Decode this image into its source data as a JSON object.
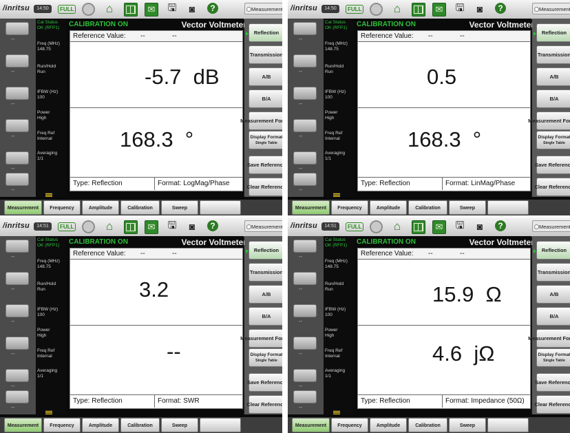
{
  "common": {
    "logo": "/inritsu",
    "full_badge": "FULL",
    "measurement_header": "Measurement",
    "cal_status_label": "Cal Status",
    "cal_status_value": "OK (RFP1)",
    "freq_label": "Freq (MHz)",
    "freq_value": "148.75",
    "runhold_label": "Run/Hold",
    "runhold_value": "Run",
    "ifbw_label": "IFBW (Hz)",
    "ifbw_value": "100",
    "power_label": "Power",
    "power_value": "High",
    "freqref_label": "Freq Ref",
    "freqref_value": "Internal",
    "averaging_label": "Averaging",
    "averaging_value": "1/1",
    "left_key_dash": "--",
    "calibration_on": "CALIBRATION ON",
    "mode_title": "Vector Voltmeter",
    "reference_label": "Reference Value:",
    "reference_dash": "--",
    "type_text": "Type: Reflection",
    "right_buttons": {
      "reflection": "Reflection",
      "transmission": "Transmission",
      "a_over_b": "A/B",
      "b_over_a": "B/A",
      "measurement_format": "Measurement Format",
      "display_format": "Display Format",
      "display_single": "Single",
      "display_table": "Table",
      "save_reference": "Save Reference",
      "clear_reference": "Clear Reference"
    },
    "bottom_tabs": [
      "Measurement",
      "Frequency",
      "Amplitude",
      "Calibration",
      "Sweep"
    ],
    "colors": {
      "accent_green": "#2ec23a",
      "active_tab": "#8fca72"
    }
  },
  "screens": [
    {
      "clock": "14:50",
      "value1": "-5.7  dB",
      "value2": "168.3  °",
      "format": "Format: LogMag/Phase"
    },
    {
      "clock": "14:50",
      "value1": "0.5",
      "value2": "168.3  °",
      "format": "Format: LinMag/Phase"
    },
    {
      "clock": "14:51",
      "value1": "3.2",
      "value2": "--",
      "format": "Format: SWR"
    },
    {
      "clock": "14:51",
      "value1": "15.9  Ω",
      "value2": "4.6  jΩ",
      "format": "Format: Impedance (50Ω)"
    }
  ]
}
